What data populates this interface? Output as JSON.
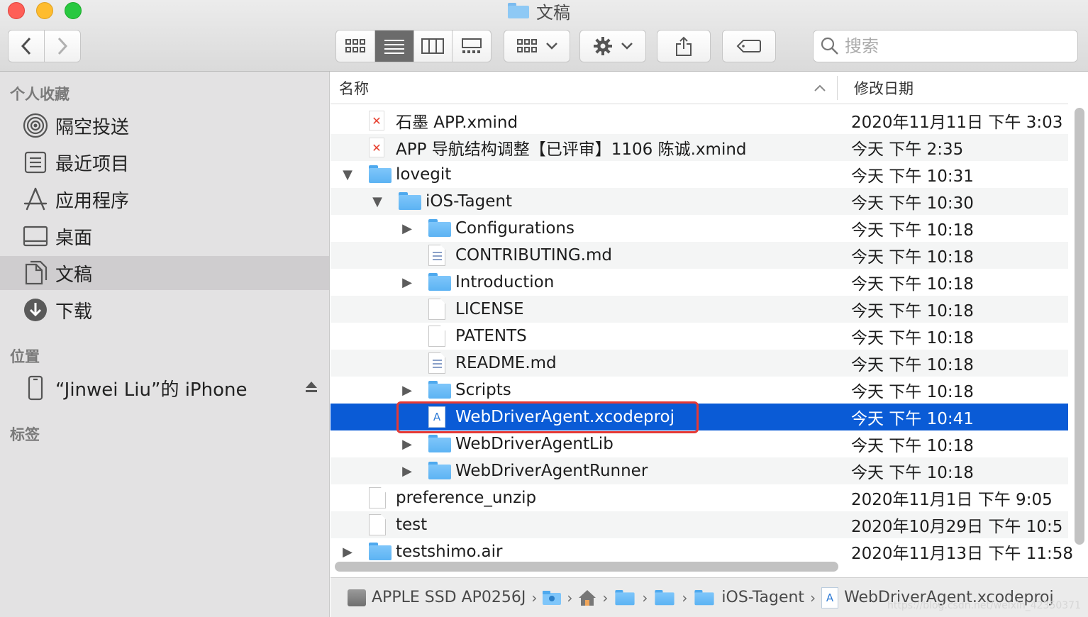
{
  "window": {
    "title": "文稿"
  },
  "toolbar": {
    "search_placeholder": "搜索"
  },
  "sidebar": {
    "favorites_title": "个人收藏",
    "favorites": [
      {
        "label": "隔空投送",
        "icon": "airdrop-icon"
      },
      {
        "label": "最近项目",
        "icon": "recents-icon"
      },
      {
        "label": "应用程序",
        "icon": "applications-icon"
      },
      {
        "label": "桌面",
        "icon": "desktop-icon"
      },
      {
        "label": "文稿",
        "icon": "documents-icon",
        "selected": true
      },
      {
        "label": "下载",
        "icon": "downloads-icon"
      }
    ],
    "locations_title": "位置",
    "locations": [
      {
        "label": "“Jinwei Liu”的 iPhone",
        "icon": "iphone-icon"
      }
    ],
    "tags_title": "标签"
  },
  "list": {
    "col_name": "名称",
    "col_date": "修改日期",
    "rows": [
      {
        "name": "石墨 APP.xmind",
        "date": "2020年11月11日 下午 3:03",
        "icon": "xmind",
        "level": 0,
        "disclosure": ""
      },
      {
        "name": "APP 导航结构调整【已评审】1106 陈诚.xmind",
        "date": "今天 下午 2:35",
        "icon": "xmind",
        "level": 0,
        "disclosure": ""
      },
      {
        "name": "lovegit",
        "date": "今天 下午 10:31",
        "icon": "folder",
        "level": 0,
        "disclosure": "▼"
      },
      {
        "name": "iOS-Tagent",
        "date": "今天 下午 10:30",
        "icon": "folder",
        "level": 1,
        "disclosure": "▼"
      },
      {
        "name": "Configurations",
        "date": "今天 下午 10:18",
        "icon": "folder",
        "level": 2,
        "disclosure": "▶"
      },
      {
        "name": "CONTRIBUTING.md",
        "date": "今天 下午 10:18",
        "icon": "doc-lines",
        "level": 2,
        "disclosure": ""
      },
      {
        "name": "Introduction",
        "date": "今天 下午 10:18",
        "icon": "folder",
        "level": 2,
        "disclosure": "▶"
      },
      {
        "name": "LICENSE",
        "date": "今天 下午 10:18",
        "icon": "doc",
        "level": 2,
        "disclosure": ""
      },
      {
        "name": "PATENTS",
        "date": "今天 下午 10:18",
        "icon": "doc",
        "level": 2,
        "disclosure": ""
      },
      {
        "name": "README.md",
        "date": "今天 下午 10:18",
        "icon": "doc-lines",
        "level": 2,
        "disclosure": ""
      },
      {
        "name": "Scripts",
        "date": "今天 下午 10:18",
        "icon": "folder",
        "level": 2,
        "disclosure": "▶"
      },
      {
        "name": "WebDriverAgent.xcodeproj",
        "date": "今天 下午 10:41",
        "icon": "xcode",
        "level": 2,
        "disclosure": "",
        "selected": true
      },
      {
        "name": "WebDriverAgentLib",
        "date": "今天 下午 10:18",
        "icon": "folder",
        "level": 2,
        "disclosure": "▶"
      },
      {
        "name": "WebDriverAgentRunner",
        "date": "今天 下午 10:18",
        "icon": "folder",
        "level": 2,
        "disclosure": "▶"
      },
      {
        "name": "preference_unzip",
        "date": "2020年11月1日 下午 9:05",
        "icon": "doc",
        "level": 0,
        "disclosure": ""
      },
      {
        "name": "test",
        "date": "2020年10月29日 下午 10:5",
        "icon": "doc",
        "level": 0,
        "disclosure": ""
      },
      {
        "name": "testshimo.air",
        "date": "2020年11月13日 下午 11:58",
        "icon": "folder",
        "level": 0,
        "disclosure": "▶"
      }
    ]
  },
  "pathbar": {
    "disk": "APPLE SSD AP0256J",
    "folder1": "iOS-Tagent",
    "item": "WebDriverAgent.xcodeproj",
    "watermark": "https://blog.csdn.net/weixin_42350371"
  },
  "colors": {
    "selection": "#0a5bd6",
    "highlight_box": "#e53935",
    "folder": "#5cb3f3"
  }
}
